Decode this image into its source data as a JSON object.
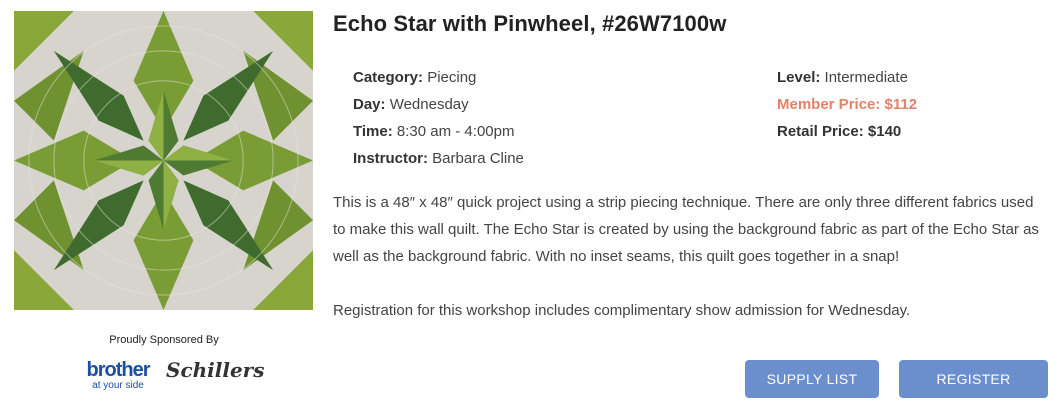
{
  "image": {
    "icon": "quilt-photo"
  },
  "sponsors": {
    "heading": "Proudly Sponsored By",
    "brother": {
      "name": "brother",
      "tagline": "at your side"
    },
    "schillers": {
      "name": "Schillers"
    }
  },
  "workshop": {
    "title": "Echo Star with Pinwheel, #26W7100w",
    "category_label": "Category:",
    "category": "Piecing",
    "day_label": "Day:",
    "day": "Wednesday",
    "time_label": "Time:",
    "time": "8:30 am - 4:00pm",
    "instructor_label": "Instructor:",
    "instructor": "Barbara Cline",
    "level_label": "Level:",
    "level": "Intermediate",
    "member_price_label": "Member Price:",
    "member_price": "$112",
    "retail_price_label": "Retail Price:",
    "retail_price": "$140",
    "description": "This is a 48″ x 48″ quick project using a strip piecing technique. There are only three different fabrics used to make this wall quilt. The Echo Star is created by using the background fabric as part of the Echo Star as well as the background fabric. With no inset seams, this quilt goes together in a snap!",
    "registration_note": "Registration for this workshop includes complimentary show admission for Wednesday."
  },
  "buttons": {
    "supply_list": "SUPPLY LIST",
    "register": "REGISTER"
  },
  "colors": {
    "accent_button": "#6b8fcc",
    "member_price": "#e58169",
    "quilt_dark_green": "#3f6b2e",
    "quilt_light_green": "#8aa83a",
    "quilt_background": "#d9d7d0"
  }
}
